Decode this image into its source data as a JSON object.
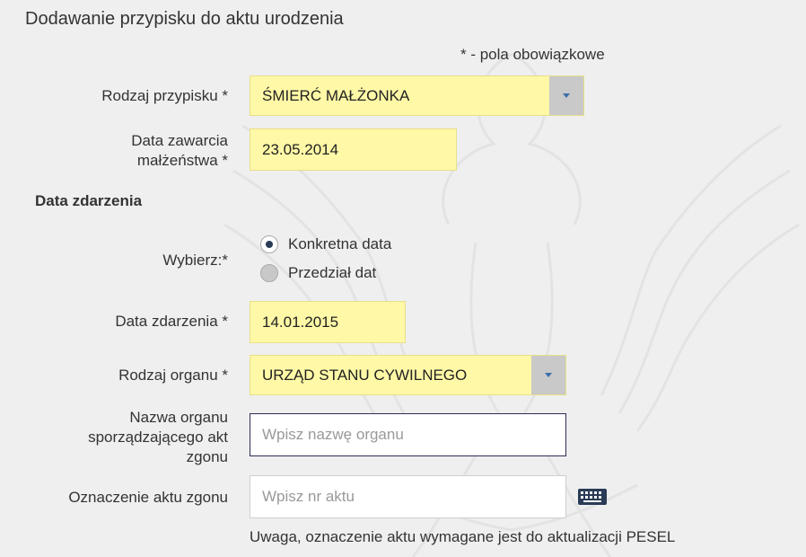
{
  "form": {
    "title": "Dodawanie przypisku do aktu urodzenia",
    "required_note": "* - pola obowiązkowe",
    "annotation_type": {
      "label": "Rodzaj przypisku *",
      "value": "ŚMIERĆ MAŁŻONKA"
    },
    "marriage_date": {
      "label_line1": "Data zawarcia",
      "label_line2": "małżeństwa *",
      "value": "23.05.2014"
    },
    "event_section": "Data zdarzenia",
    "choose": {
      "label": "Wybierz:*",
      "options": [
        "Konkretna data",
        "Przedział dat"
      ],
      "selected": "Konkretna data"
    },
    "event_date": {
      "label": "Data zdarzenia *",
      "value": "14.01.2015"
    },
    "authority_type": {
      "label": "Rodzaj organu *",
      "value": "URZĄD STANU CYWILNEGO"
    },
    "authority_name": {
      "label_line1": "Nazwa organu",
      "label_line2": "sporządzającego akt",
      "label_line3": "zgonu",
      "placeholder": "Wpisz nazwę organu"
    },
    "death_act": {
      "label": "Oznaczenie aktu zgonu",
      "placeholder": "Wpisz nr aktu"
    },
    "warning": "Uwaga, oznaczenie aktu wymagane jest do aktualizacji PESEL"
  },
  "colors": {
    "background": "#efefef",
    "required_field": "#fff8a6",
    "select_arrow_bg": "#c9c9c9",
    "focus_border": "#2d2d55"
  },
  "icons": {
    "dropdown": "caret-down-icon",
    "keyboard": "keyboard-icon",
    "watermark": "eagle-emblem-watermark"
  }
}
